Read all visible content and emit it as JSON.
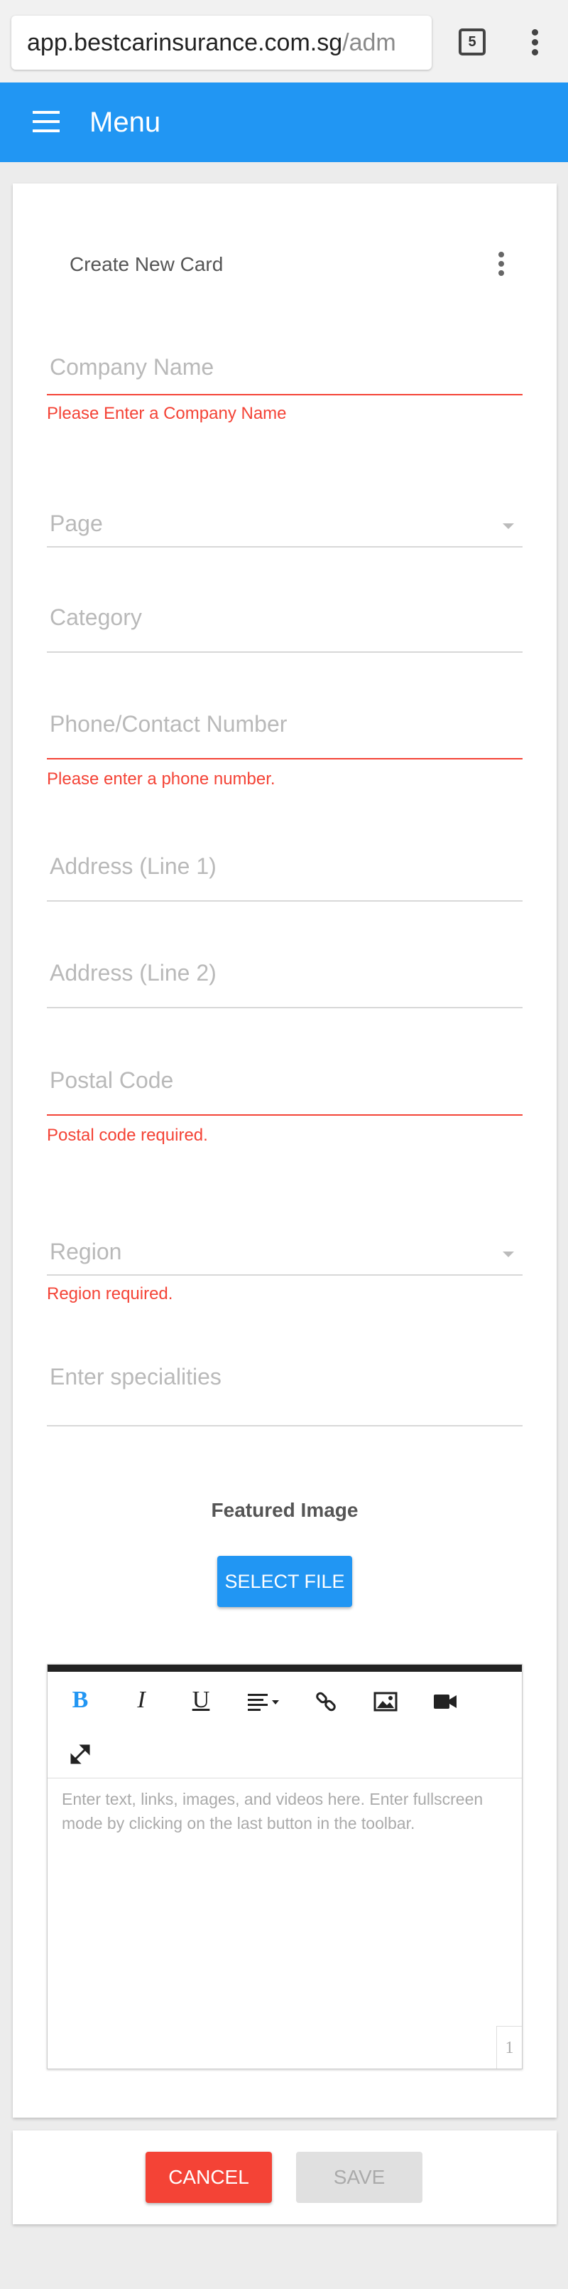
{
  "browser": {
    "url_main": "app.bestcarinsurance.com.sg",
    "url_path": "/adm",
    "tab_count": "5"
  },
  "appbar": {
    "title": "Menu"
  },
  "card": {
    "title": "Create New Card"
  },
  "fields": {
    "company_name": {
      "placeholder": "Company Name",
      "error": "Please Enter a Company Name"
    },
    "page": {
      "placeholder": "Page"
    },
    "category": {
      "placeholder": "Category"
    },
    "phone": {
      "placeholder": "Phone/Contact Number",
      "error": "Please enter a phone number."
    },
    "address1": {
      "placeholder": "Address (Line 1)"
    },
    "address2": {
      "placeholder": "Address (Line 2)"
    },
    "postal": {
      "placeholder": "Postal Code",
      "error": "Postal code required."
    },
    "region": {
      "placeholder": "Region",
      "error": "Region required."
    },
    "specialities": {
      "placeholder": "Enter specialities"
    }
  },
  "featured_image": {
    "label": "Featured Image",
    "button": "SELECT FILE"
  },
  "editor": {
    "placeholder": "Enter text, links, images, and videos here. Enter fullscreen mode by clicking on the last button in the toolbar.",
    "word_count": "1",
    "toolbar": {
      "bold": "B",
      "italic": "I",
      "underline": "U"
    }
  },
  "actions": {
    "cancel": "CANCEL",
    "save": "SAVE"
  },
  "colors": {
    "primary": "#2196f3",
    "error": "#f44336",
    "disabled": "#e0e0e0"
  }
}
